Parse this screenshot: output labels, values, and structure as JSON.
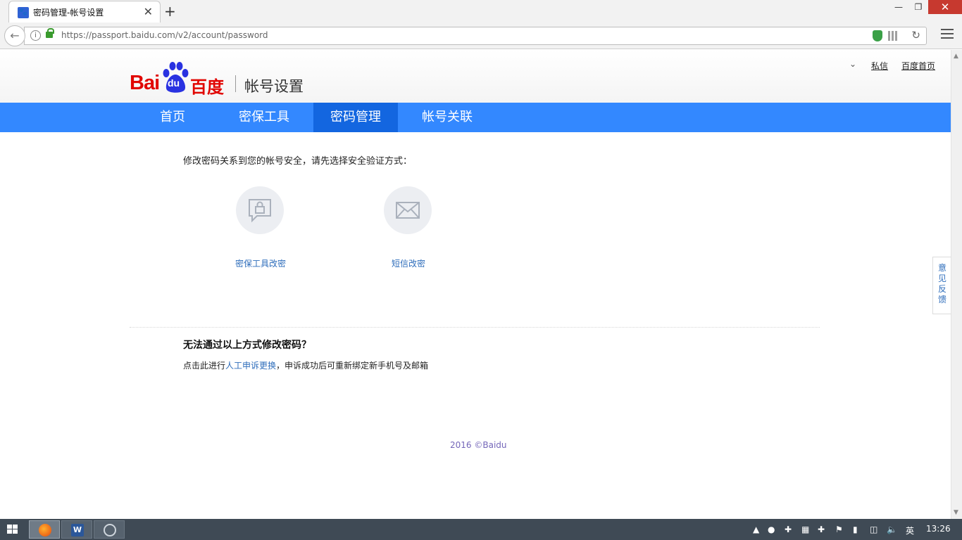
{
  "browser": {
    "tab_title": "密码管理-帐号设置",
    "url": "https://passport.baidu.com/v2/account/password",
    "win_min": "—",
    "win_max": "❐",
    "win_close": "✕",
    "new_tab": "+",
    "tab_close": "✕"
  },
  "header": {
    "logo_latin": "Bai",
    "logo_du": "du",
    "logo_cn": "百度",
    "site_title": "帐号设置",
    "dropdown_icon": "⌄",
    "links": [
      "私信",
      "百度首页"
    ]
  },
  "nav": {
    "items": [
      "首页",
      "密保工具",
      "密码管理",
      "帐号关联"
    ],
    "active_index": 2
  },
  "content": {
    "prompt": "修改密码关系到您的帐号安全，请先选择安全验证方式：",
    "options": [
      {
        "label": "密保工具改密",
        "icon": "lock-message-icon"
      },
      {
        "label": "短信改密",
        "icon": "envelope-icon"
      }
    ],
    "help_title": "无法通过以上方式修改密码？",
    "help_prefix": "点击此进行",
    "help_link": "人工申诉更换",
    "help_suffix": "，申诉成功后可重新绑定新手机号及邮箱"
  },
  "footer": {
    "copyright": "2016 ©Baidu"
  },
  "feedback": {
    "label": "意见反馈"
  },
  "taskbar": {
    "clock": "13:26",
    "ime": "英"
  },
  "colors": {
    "nav_blue": "#3388ff",
    "nav_active": "#1366e0",
    "brand_red": "#e10602",
    "brand_blue": "#2932e1",
    "link_blue": "#2e6dbb"
  }
}
